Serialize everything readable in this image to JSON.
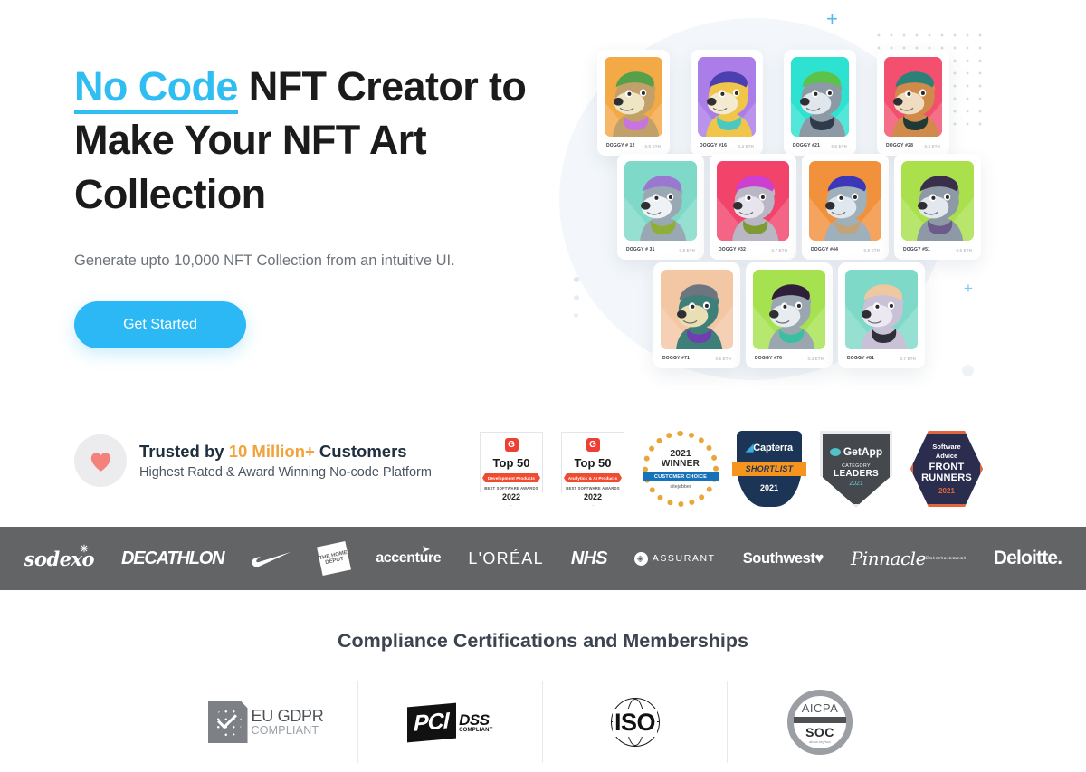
{
  "hero": {
    "headline_accent": "No Code",
    "headline_rest": " NFT Creator to Make Your NFT Art Collection",
    "subhead": "Generate upto 10,000 NFT Collection from an intuitive UI.",
    "cta_label": "Get Started",
    "accent_color": "#30bdf2",
    "cta_color": "#2cb8f4"
  },
  "trust": {
    "icon": "heart-icon",
    "line1_prefix": "Trusted by ",
    "line1_number": "10 Million+",
    "line1_suffix": " Customers",
    "line2": "Highest Rated & Award Winning No-code Platform",
    "number_color": "#f2a33c"
  },
  "awards": [
    {
      "type": "g2",
      "mark": "G",
      "top": "Top 50",
      "category": "Development Products",
      "award": "BEST SOFTWARE AWARDS",
      "year": "2022"
    },
    {
      "type": "g2",
      "mark": "G",
      "top": "Top 50",
      "category": "Analytics & AI Products",
      "award": "BEST SOFTWARE AWARDS",
      "year": "2022"
    },
    {
      "type": "seal",
      "year": "2021",
      "winner": "WINNER",
      "band": "CUSTOMER CHOICE",
      "source": "sitejabber"
    },
    {
      "type": "shield",
      "brand": "Capterra",
      "ribbon": "SHORTLIST",
      "year": "2021"
    },
    {
      "type": "diamond",
      "brand": "GetApp",
      "line1": "CATEGORY",
      "line2": "LEADERS",
      "year": "2021"
    },
    {
      "type": "hexagon",
      "brand1": "Software",
      "brand2": "Advice",
      "line1": "FRONT",
      "line2": "RUNNERS",
      "year": "2021"
    }
  ],
  "nft_cards": [
    {
      "name": "DOGGY # 12",
      "price": "0.5 ETH",
      "bg": "#f4a947",
      "fur": "#c2a06a",
      "face": "#ede5c4",
      "hair": "#57a04a",
      "acc": "#c773e0",
      "row": 1
    },
    {
      "name": "DOGGY #16",
      "price": "0.4 ETH",
      "bg": "#ab7de8",
      "fur": "#f0c64a",
      "face": "#f3ead0",
      "hair": "#4c3fb0",
      "acc": "#49c9c2",
      "row": 1
    },
    {
      "name": "DOGGY #21",
      "price": "0.6 ETH",
      "bg": "#2ee2d2",
      "fur": "#8d9aa6",
      "face": "#dfe6ec",
      "hair": "#5bc24a",
      "acc": "#2f3b4a",
      "row": 1
    },
    {
      "name": "DOGGY #28",
      "price": "0.3 ETH",
      "bg": "#f2506e",
      "fur": "#d08a4a",
      "face": "#f0dcc0",
      "hair": "#2d7f7a",
      "acc": "#1f3a36",
      "row": 1
    },
    {
      "name": "DOGGY # 31",
      "price": "0.8 ETH",
      "bg": "#7fd9c8",
      "fur": "#9aa8b4",
      "face": "#eef2f5",
      "hair": "#9a78d0",
      "acc": "#8fae35",
      "row": 2
    },
    {
      "name": "DOGGY #32",
      "price": "0.7 ETH",
      "bg": "#f2436a",
      "fur": "#b9b6c6",
      "face": "#e8e4ee",
      "hair": "#cc3fd0",
      "acc": "#7f9a35",
      "row": 2
    },
    {
      "name": "DOGGY #44",
      "price": "0.9 ETH",
      "bg": "#f2913c",
      "fur": "#9fb0bd",
      "face": "#dfe8ee",
      "hair": "#3c36b8",
      "acc": "#bfa47d",
      "row": 2
    },
    {
      "name": "DOGGY #51",
      "price": "0.5 ETH",
      "bg": "#a9e04c",
      "fur": "#8d9aa6",
      "face": "#e2e8ee",
      "hair": "#3a2f4a",
      "acc": "#6b5a8a",
      "row": 2
    },
    {
      "name": "DOGGY #71",
      "price": "0.6 ETH",
      "bg": "#f3c6a4",
      "fur": "#3f7f7a",
      "face": "#eadfb4",
      "hair": "#6c7580",
      "acc": "#6f3fb0",
      "row": 3
    },
    {
      "name": "DOGGY #76",
      "price": "0.4 ETH",
      "bg": "#a6e24f",
      "fur": "#9aa6b0",
      "face": "#e6ecef",
      "hair": "#2f1f3a",
      "acc": "#3bbfa0",
      "row": 3
    },
    {
      "name": "DOGGY #81",
      "price": "0.7 ETH",
      "bg": "#7fd9c8",
      "fur": "#c9c2d6",
      "face": "#ece8f2",
      "hair": "#f0c8a0",
      "acc": "#2f2f3a",
      "row": 3
    }
  ],
  "client_logos": [
    {
      "name": "sodexo",
      "label": "sodexo"
    },
    {
      "name": "decathlon",
      "label": "DECATHLON"
    },
    {
      "name": "nike",
      "label": "Nike"
    },
    {
      "name": "home-depot",
      "label": "THE HOME DEPOT"
    },
    {
      "name": "accenture",
      "label": "accenture"
    },
    {
      "name": "loreal",
      "label": "L'ORÉAL"
    },
    {
      "name": "nhs",
      "label": "NHS"
    },
    {
      "name": "assurant",
      "label": "ASSURANT"
    },
    {
      "name": "southwest",
      "label": "Southwest"
    },
    {
      "name": "pinnacle",
      "label": "Pinnacle",
      "sub": "Entertainment"
    },
    {
      "name": "deloitte",
      "label": "Deloitte."
    }
  ],
  "compliance": {
    "title": "Compliance Certifications and Memberships",
    "items": [
      {
        "name": "eu-gdpr",
        "line1": "EU GDPR",
        "line2": "COMPLIANT"
      },
      {
        "name": "pci-dss",
        "line1": "PCI",
        "line2": "DSS",
        "line3": "COMPLIANT"
      },
      {
        "name": "iso",
        "line1": "ISO"
      },
      {
        "name": "aicpa-soc",
        "line1": "AICPA",
        "line2": "SOC",
        "line3": "aicpa.org/soc"
      }
    ]
  },
  "logobar_color": "#636466"
}
